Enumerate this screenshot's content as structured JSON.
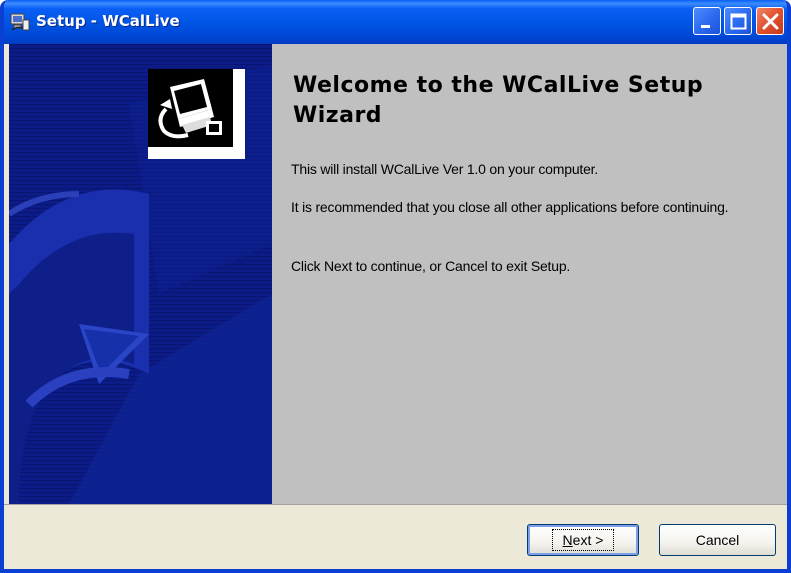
{
  "window": {
    "title": "Setup - WCalLive",
    "app_icon": "setup-computer-icon",
    "controls": [
      "minimize-icon",
      "maximize-icon",
      "close-icon"
    ]
  },
  "banner": {
    "icon": "installer-computer-icon"
  },
  "content": {
    "heading": "Welcome to the WCalLive Setup Wizard",
    "paragraph1": "This will install WCalLive Ver 1.0 on your computer.",
    "paragraph2": "It is recommended that you close all other applications before continuing.",
    "paragraph3": "Click Next to continue, or Cancel to exit Setup."
  },
  "buttons": {
    "next_accel": "N",
    "next_rest": "ext",
    "next_arrow": ">",
    "cancel_label": "Cancel"
  },
  "colors": {
    "titlebar": "#0054e3",
    "banner": "#0c1a7a",
    "content_bg": "#c0c0c0",
    "footer_bg": "#ece9d8",
    "close_button": "#e2502e"
  }
}
